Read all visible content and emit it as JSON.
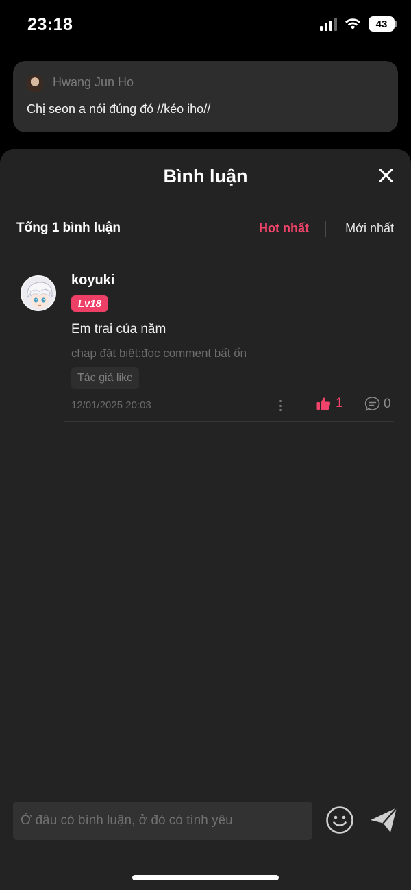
{
  "status_bar": {
    "time": "23:18",
    "battery": "43"
  },
  "reply_preview": {
    "author": "Hwang Jun Ho",
    "text": "Chị seon a nói đúng đó //kéo iho//"
  },
  "sheet": {
    "title": "Bình luận",
    "total_label": "Tổng 1 bình luận",
    "sort_hot": "Hot nhất",
    "sort_new": "Mới nhất"
  },
  "comment": {
    "author": "koyuki",
    "level": "Lv18",
    "text": "Em trai của năm",
    "chapter": "chap đặt biệt:đọc comment bất ổn",
    "tag": "Tác giả like",
    "date": "12/01/2025 20:03",
    "likes": "1",
    "replies": "0"
  },
  "input": {
    "placeholder": "Ở đâu có bình luận, ở đó có tình yêu"
  },
  "colors": {
    "accent": "#f2436a",
    "sheet_bg": "#232323",
    "badge": "#ee3f67"
  },
  "icons": [
    "signal-icon",
    "wifi-icon",
    "battery-icon",
    "close-icon",
    "more-icon",
    "thumbs-up-icon",
    "comment-bubble-icon",
    "emoji-icon",
    "send-icon"
  ]
}
